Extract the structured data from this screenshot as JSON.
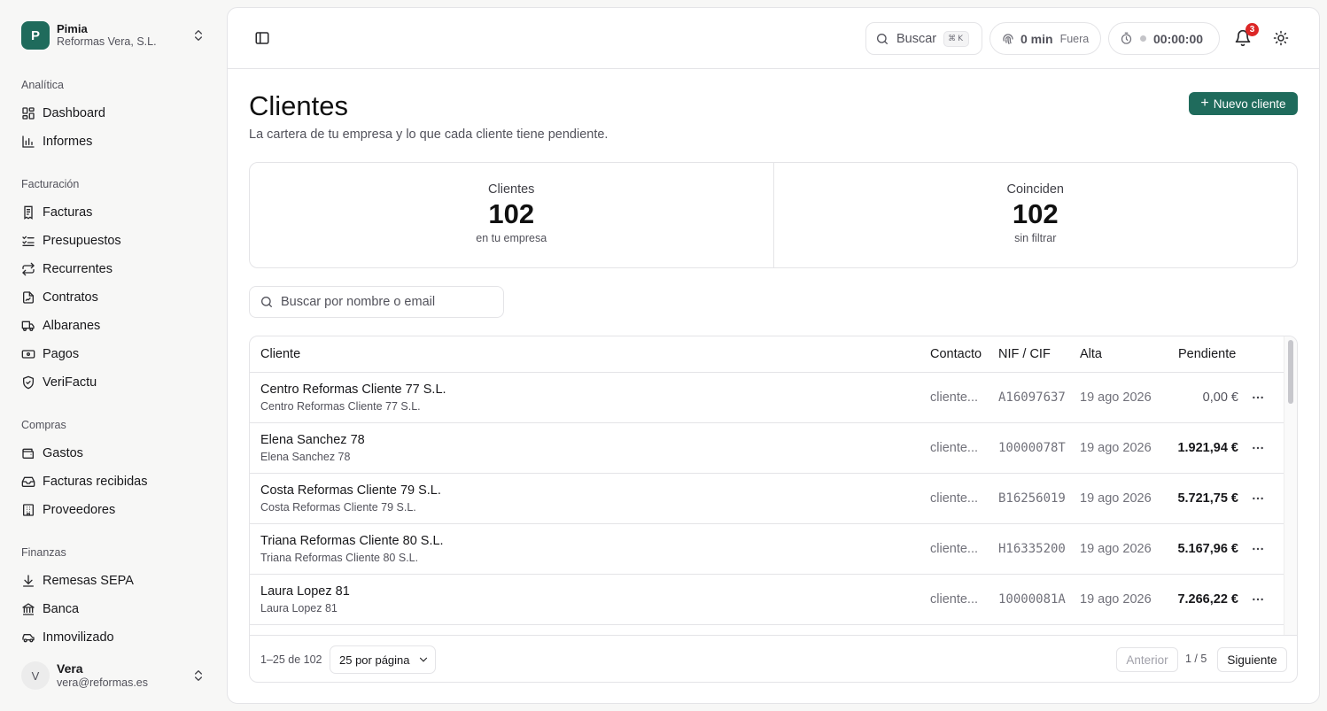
{
  "org": {
    "initial": "P",
    "name": "Pimia",
    "company": "Reformas Vera, S.L."
  },
  "sidebar": {
    "sections": [
      {
        "title": "Analítica",
        "items": [
          {
            "label": "Dashboard",
            "icon": "dashboard-icon"
          },
          {
            "label": "Informes",
            "icon": "bar-chart-icon"
          }
        ]
      },
      {
        "title": "Facturación",
        "items": [
          {
            "label": "Facturas",
            "icon": "invoice-icon"
          },
          {
            "label": "Presupuestos",
            "icon": "checklist-icon"
          },
          {
            "label": "Recurrentes",
            "icon": "repeat-icon"
          },
          {
            "label": "Contratos",
            "icon": "contract-icon"
          },
          {
            "label": "Albaranes",
            "icon": "truck-icon"
          },
          {
            "label": "Pagos",
            "icon": "banknote-icon"
          },
          {
            "label": "VeriFactu",
            "icon": "shield-check-icon"
          }
        ]
      },
      {
        "title": "Compras",
        "items": [
          {
            "label": "Gastos",
            "icon": "wallet-icon"
          },
          {
            "label": "Facturas recibidas",
            "icon": "inbox-icon"
          },
          {
            "label": "Proveedores",
            "icon": "building-icon"
          }
        ]
      },
      {
        "title": "Finanzas",
        "items": [
          {
            "label": "Remesas SEPA",
            "icon": "download-icon"
          },
          {
            "label": "Banca",
            "icon": "bank-icon"
          },
          {
            "label": "Inmovilizado",
            "icon": "car-icon"
          }
        ]
      }
    ]
  },
  "user": {
    "initial": "V",
    "name": "Vera",
    "email": "vera@reformas.es"
  },
  "topbar": {
    "search_label": "Buscar",
    "shortcut": "⌘K",
    "time_value": "0 min",
    "time_status": "Fuera",
    "timer": "00:00:00",
    "notifications": "3"
  },
  "page": {
    "title": "Clientes",
    "subtitle": "La cartera de tu empresa y lo que cada cliente tiene pendiente.",
    "new_button": "Nuevo cliente"
  },
  "stats": [
    {
      "label": "Clientes",
      "value": "102",
      "note": "en tu empresa"
    },
    {
      "label": "Coinciden",
      "value": "102",
      "note": "sin filtrar"
    }
  ],
  "filter": {
    "placeholder": "Buscar por nombre o email"
  },
  "table": {
    "columns": {
      "cliente": "Cliente",
      "contacto": "Contacto",
      "nif": "NIF / CIF",
      "alta": "Alta",
      "pendiente": "Pendiente"
    },
    "rows": [
      {
        "name": "Centro Reformas Cliente 77 S.L.",
        "sub": "Centro Reformas Cliente 77 S.L.",
        "contact": "cliente...",
        "nif": "A16097637",
        "alta": "19 ago 2026",
        "pendiente": "0,00 €"
      },
      {
        "name": "Elena Sanchez 78",
        "sub": "Elena Sanchez 78",
        "contact": "cliente...",
        "nif": "10000078T",
        "alta": "19 ago 2026",
        "pendiente": "1.921,94 €"
      },
      {
        "name": "Costa Reformas Cliente 79 S.L.",
        "sub": "Costa Reformas Cliente 79 S.L.",
        "contact": "cliente...",
        "nif": "B16256019",
        "alta": "19 ago 2026",
        "pendiente": "5.721,75 €"
      },
      {
        "name": "Triana Reformas Cliente 80 S.L.",
        "sub": "Triana Reformas Cliente 80 S.L.",
        "contact": "cliente...",
        "nif": "H16335200",
        "alta": "19 ago 2026",
        "pendiente": "5.167,96 €"
      },
      {
        "name": "Laura Lopez 81",
        "sub": "Laura Lopez 81",
        "contact": "cliente...",
        "nif": "10000081A",
        "alta": "19 ago 2026",
        "pendiente": "7.266,22 €"
      }
    ],
    "footer": {
      "range": "1–25 de 102",
      "per_page": "25 por página",
      "prev": "Anterior",
      "page": "1 / 5",
      "next": "Siguiente"
    }
  },
  "colors": {
    "brand": "#1f6b5c",
    "badge": "#dc2626"
  }
}
